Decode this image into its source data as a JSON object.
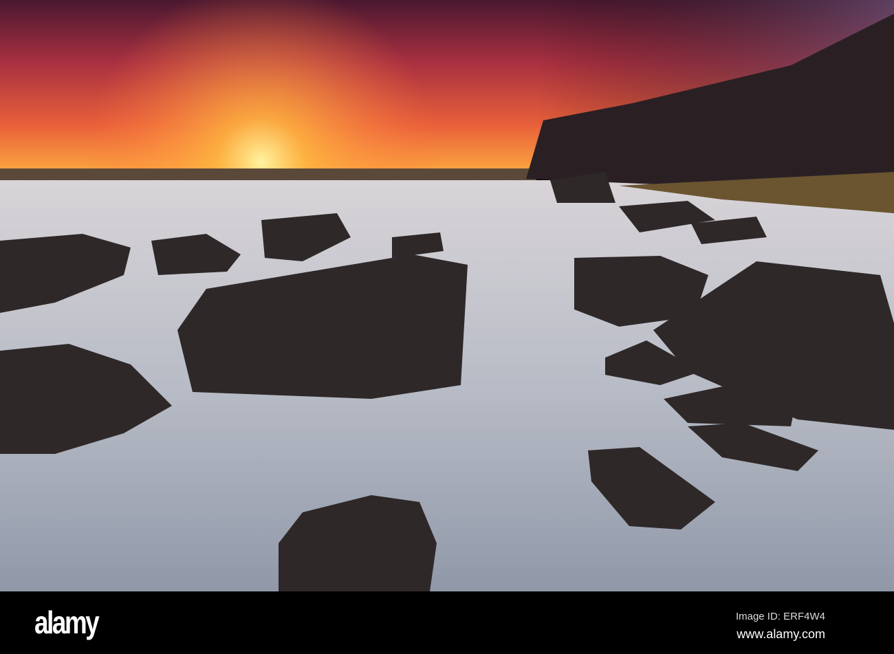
{
  "watermark": {
    "logo": "alamy",
    "image_id": "Image ID: ERF4W4",
    "url": "www.alamy.com"
  },
  "colors": {
    "sky_top": "#5a1a2e",
    "sun": "#ffd34a",
    "water": "#c8ccd4",
    "rock": "#2c2626"
  }
}
